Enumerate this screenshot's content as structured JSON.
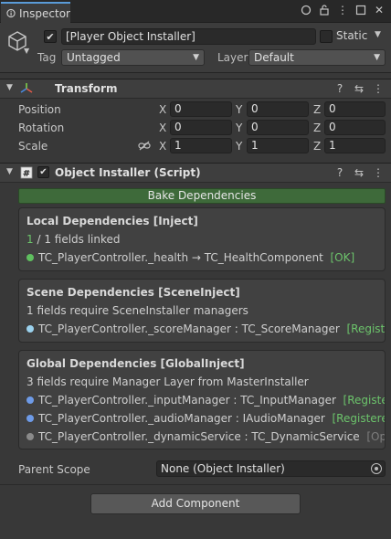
{
  "tab": {
    "title": "Inspector",
    "icons": [
      "window-options-icon",
      "lock-icon",
      "menu-icon",
      "maximize-icon",
      "close-icon"
    ]
  },
  "header": {
    "object_name": "[Player Object Installer]",
    "active": true,
    "static_label": "Static",
    "tag_label": "Tag",
    "tag_value": "Untagged",
    "layer_label": "Layer",
    "layer_value": "Default"
  },
  "transform": {
    "title": "Transform",
    "position_label": "Position",
    "rotation_label": "Rotation",
    "scale_label": "Scale",
    "x_label": "X",
    "y_label": "Y",
    "z_label": "Z",
    "position": {
      "x": "0",
      "y": "0",
      "z": "0"
    },
    "rotation": {
      "x": "0",
      "y": "0",
      "z": "0"
    },
    "scale": {
      "x": "1",
      "y": "1",
      "z": "1"
    }
  },
  "script": {
    "title": "Object Installer (Script)",
    "enabled": true,
    "bake_label": "Bake Dependencies"
  },
  "local": {
    "title": "Local Dependencies [Inject]",
    "count_linked": "1",
    "count_rest": " / 1 fields linked",
    "items": [
      {
        "text": "TC_PlayerController._health → TC_HealthComponent",
        "status": "[OK]",
        "dot": "#5fbf5f"
      }
    ]
  },
  "scene": {
    "title": "Scene Dependencies [SceneInject]",
    "summary": "1 fields require SceneInstaller managers",
    "items": [
      {
        "text": "TC_PlayerController._scoreManager : TC_ScoreManager",
        "status": "[Registered]",
        "dot": "#9bd2ee"
      }
    ]
  },
  "global": {
    "title": "Global Dependencies [GlobalInject]",
    "summary": "3 fields require Manager Layer from MasterInstaller",
    "items": [
      {
        "text": "TC_PlayerController._inputManager : TC_InputManager",
        "status": "[Registered]",
        "dot": "#6e9be8"
      },
      {
        "text": "TC_PlayerController._audioManager : IAudioManager",
        "status": "[Registered]",
        "dot": "#6e9be8"
      },
      {
        "text": "TC_PlayerController._dynamicService : TC_DynamicService",
        "status": "[Optional]",
        "dot": "#8a8a8a"
      }
    ]
  },
  "parent_scope": {
    "label": "Parent Scope",
    "value": "None (Object Installer)"
  },
  "add_component": "Add Component",
  "colors": {
    "accent_tab": "#5a9bd8",
    "bake_green": "#3e6a3a",
    "ok_green": "#6cc46b"
  }
}
